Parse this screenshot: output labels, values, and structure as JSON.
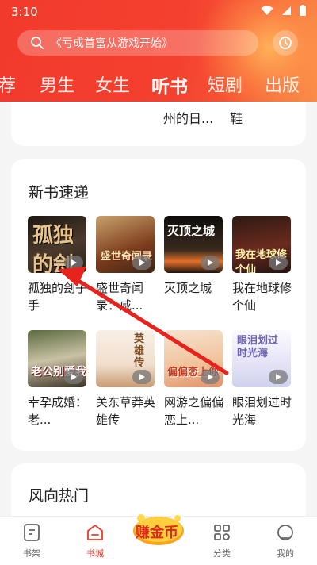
{
  "status": {
    "time": "3:10"
  },
  "search": {
    "placeholder": "《亏成首富从游戏开始》"
  },
  "tabs": [
    {
      "label": "荐",
      "active": false
    },
    {
      "label": "男生",
      "active": false
    },
    {
      "label": "女生",
      "active": false
    },
    {
      "label": "听书",
      "active": true
    },
    {
      "label": "短剧",
      "active": false
    },
    {
      "label": "出版",
      "active": false
    }
  ],
  "prev_fragments": {
    "left": "州的日...",
    "right": "鞋"
  },
  "new_books": {
    "title": "新书速递",
    "books": [
      {
        "title": "孤独的刽子手",
        "cover_text": "孤独的刽子手"
      },
      {
        "title": "盛世奇闻录：咸...",
        "cover_text": "盛世奇闻录"
      },
      {
        "title": "灭顶之城",
        "cover_text": "灭顶之城"
      },
      {
        "title": "我在地球修个仙",
        "cover_text": "我在地球修个仙"
      },
      {
        "title": "幸孕成婚：老...",
        "cover_text": "老公别爱我"
      },
      {
        "title": "关东草莽英雄传",
        "cover_text": "英雄传"
      },
      {
        "title": "网游之偏偏恋上...",
        "cover_text": "偏偏恋上你"
      },
      {
        "title": "眼泪划过时光海",
        "cover_text": "眼泪划过时光海"
      }
    ]
  },
  "trending": {
    "title": "风向热门"
  },
  "nav": {
    "shelf": "书架",
    "store": "书城",
    "coin": "赚金币",
    "category": "分类",
    "mine": "我的"
  },
  "colors": {
    "accent": "#ec3b2c",
    "header": "#f23a2c"
  }
}
